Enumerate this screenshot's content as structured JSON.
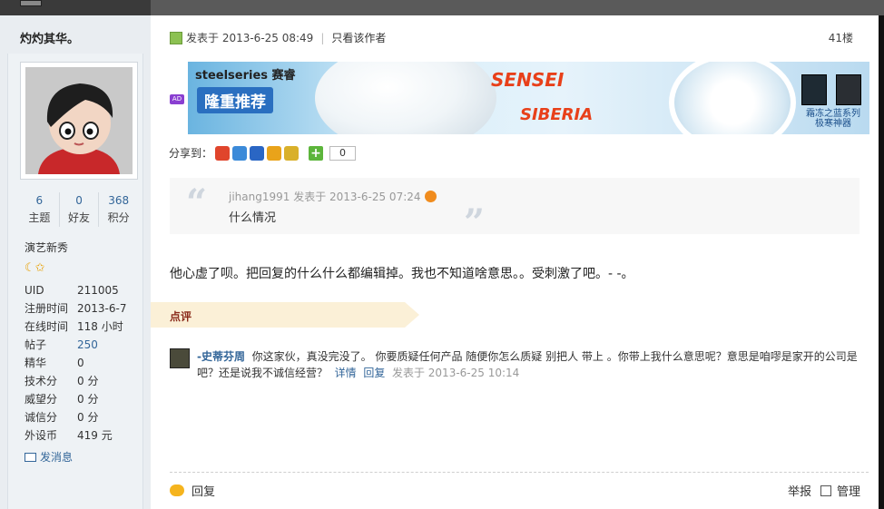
{
  "user": {
    "name": "灼灼其华。",
    "stats": [
      {
        "num": "6",
        "label": "主题"
      },
      {
        "num": "0",
        "label": "好友"
      },
      {
        "num": "368",
        "label": "积分"
      }
    ],
    "rank": "演艺新秀",
    "stars": "☾✩",
    "info": [
      {
        "k": "UID",
        "v": "211005"
      },
      {
        "k": "注册时间",
        "v": "2013-6-7"
      },
      {
        "k": "在线时间",
        "v": "118 小时"
      },
      {
        "k": "帖子",
        "v": "250"
      },
      {
        "k": "精华",
        "v": "0"
      },
      {
        "k": "技术分",
        "v": "0 分"
      },
      {
        "k": "威望分",
        "v": "0 分"
      },
      {
        "k": "诚信分",
        "v": "0 分"
      },
      {
        "k": "外设币",
        "v": "419 元"
      }
    ],
    "send_msg": "发消息"
  },
  "post": {
    "posted_at": "发表于 2013-6-25 08:49",
    "author_only": "只看该作者",
    "floor": "41楼",
    "ad_tag": "AD",
    "banner": {
      "brand": "steelseries 赛睿",
      "promo": "隆重推荐",
      "sensei": "SENSEI",
      "siberia": "SIBERIA",
      "caption_line1": "霜冻之蓝系列",
      "caption_line2": "极寒神器"
    },
    "share_label": "分享到：",
    "share_count": "0",
    "quote": {
      "header": "jihang1991 发表于 2013-6-25 07:24",
      "text": "什么情况"
    },
    "body": "他心虚了呗。把回复的什么什么都编辑掉。我也不知道啥意思。。受刺激了吧。- -。"
  },
  "comments": {
    "label": "点评",
    "items": [
      {
        "user": "-史蒂芬周",
        "text": "你这家伙，真没完没了。 你要质疑任何产品 随便你怎么质疑 别把人 带上 。你带上我什么意思呢？意思是咱嘐是家开的公司是吧？还是说我不诚信经营？",
        "detail": "详情",
        "reply": "回复",
        "time": "发表于 2013-6-25 10:14"
      }
    ]
  },
  "footer": {
    "reply": "回复",
    "report": "举报",
    "manage": "管理"
  },
  "colors": {
    "link": "#336699",
    "comment_bar": "#fbf0d7",
    "comment_label": "#8a2a1a"
  }
}
